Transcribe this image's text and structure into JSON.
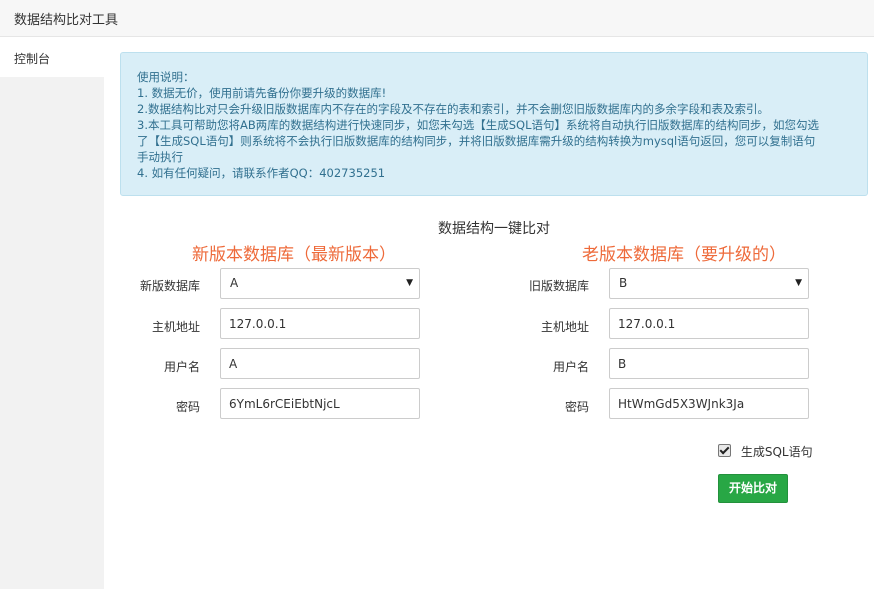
{
  "app": {
    "title": "数据结构比对工具"
  },
  "sidebar": {
    "items": [
      {
        "label": "控制台"
      }
    ]
  },
  "instructions": {
    "lines": [
      "使用说明：",
      "1. 数据无价，使用前请先备份你要升级的数据库!",
      "2.数据结构比对只会升级旧版数据库内不存在的字段及不存在的表和索引，并不会删您旧版数据库内的多余字段和表及索引。",
      "3.本工具可帮助您将AB两库的数据结构进行快速同步，如您未勾选【生成SQL语句】系统将自动执行旧版数据库的结构同步，如您勾选",
      "了【生成SQL语句】则系统将不会执行旧版数据库的结构同步，并将旧版数据库需升级的结构转换为mysql语句返回，您可以复制语句",
      "手动执行",
      "4. 如有任何疑问，请联系作者QQ：402735251"
    ]
  },
  "main": {
    "section_title": "数据结构一键比对"
  },
  "new_db": {
    "title": "新版本数据库（最新版本）",
    "db_label": "新版数据库",
    "db_value": "A",
    "host_label": "主机地址",
    "host_value": "127.0.0.1",
    "user_label": "用户名",
    "user_value": "A",
    "pass_label": "密码",
    "pass_value": "6YmL6rCEiEbtNjcL"
  },
  "old_db": {
    "title": "老版本数据库（要升级的）",
    "db_label": "旧版数据库",
    "db_value": "B",
    "host_label": "主机地址",
    "host_value": "127.0.0.1",
    "user_label": "用户名",
    "user_value": "B",
    "pass_label": "密码",
    "pass_value": "HtWmGd5X3WJnk3Ja"
  },
  "options": {
    "generate_sql_label": "生成SQL语句",
    "generate_sql_checked": true
  },
  "actions": {
    "start_label": "开始比对"
  },
  "icons": {
    "dropdown": "caret-down-icon",
    "check": "checkmark-icon"
  },
  "colors": {
    "column_title": "#ee6a3a",
    "start_button": "#28a745",
    "info_bg": "#d9eef7"
  }
}
